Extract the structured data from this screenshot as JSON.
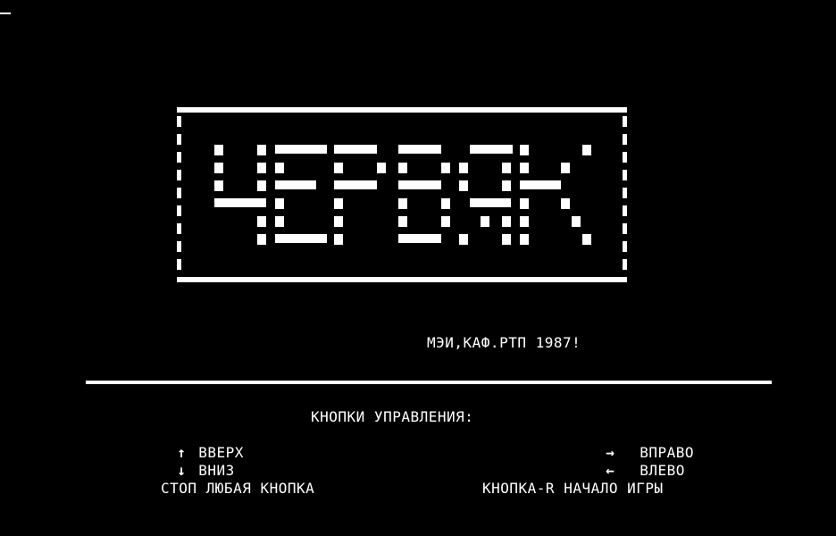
{
  "game": {
    "title": "ЧЕРВЯК",
    "credit": "МЭИ,КАФ.РТП 1987!",
    "controls": {
      "heading": "КНОПКИ УПРАВЛЕНИЯ:",
      "up": {
        "glyph": "↑",
        "label": "ВВЕРХ"
      },
      "down": {
        "glyph": "↓",
        "label": "ВНИЗ"
      },
      "right": {
        "glyph": "→",
        "label": "ВПРАВО"
      },
      "left": {
        "glyph": "←",
        "label": "ВЛЕВО"
      },
      "stop": "СТОП ЛЮБАЯ КНОПКА",
      "restart": "КНОПКА-R НАЧАЛО ИГРЫ"
    }
  },
  "colors": {
    "background": "#000000",
    "foreground": "#ffffff"
  }
}
